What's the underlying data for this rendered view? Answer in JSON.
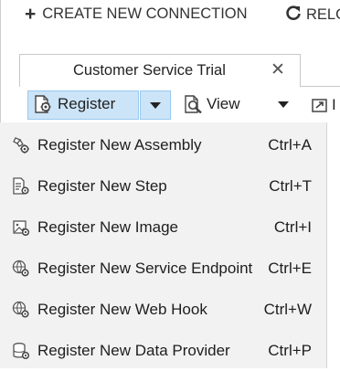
{
  "topbar": {
    "create_label": "CREATE NEW CONNECTION",
    "reload_label": "RELO"
  },
  "tab": {
    "title": "Customer Service Trial",
    "close_glyph": "✕"
  },
  "toolbar": {
    "register_label": "Register",
    "view_label": "View",
    "next_label": "I"
  },
  "menu": {
    "items": [
      {
        "label": "Register New Assembly",
        "shortcut": "Ctrl+A",
        "icon": "assembly-icon"
      },
      {
        "label": "Register New Step",
        "shortcut": "Ctrl+T",
        "icon": "step-icon"
      },
      {
        "label": "Register New Image",
        "shortcut": "Ctrl+I",
        "icon": "image-icon"
      },
      {
        "label": "Register New Service Endpoint",
        "shortcut": "Ctrl+E",
        "icon": "service-endpoint-icon"
      },
      {
        "label": "Register New Web Hook",
        "shortcut": "Ctrl+W",
        "icon": "web-hook-icon"
      },
      {
        "label": "Register New Data Provider",
        "shortcut": "Ctrl+P",
        "icon": "data-provider-icon"
      }
    ]
  },
  "colors": {
    "menu_background": "#f2f2f2",
    "button_highlight": "#cce4f7",
    "button_border": "#99c9ef",
    "text": "#1e1e1e"
  }
}
